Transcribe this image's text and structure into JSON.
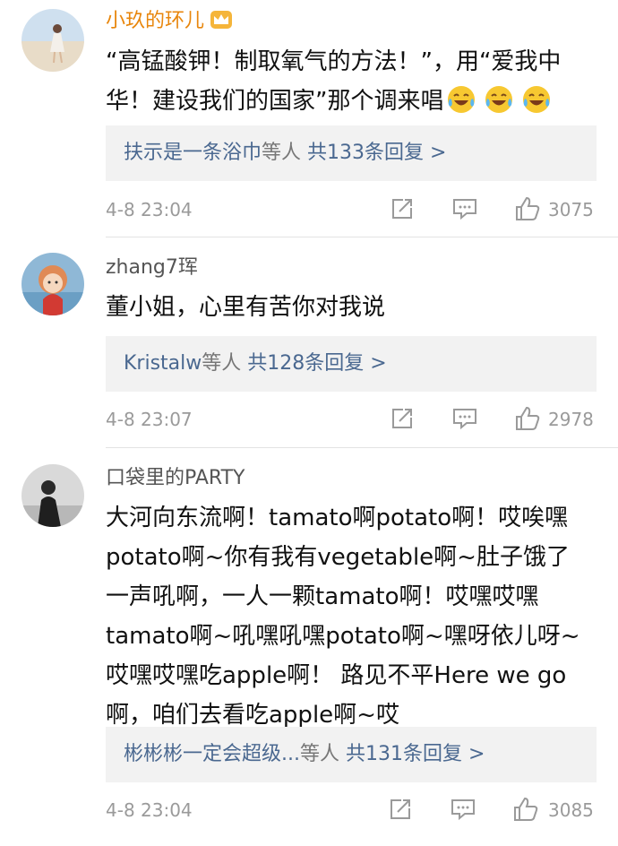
{
  "comments": [
    {
      "username": "小玖的环儿",
      "username_color": "#e8860c",
      "badge": "crown-icon",
      "lines": [
        "“高锰酸钾！制取氧气的方法！”，用“爱我中",
        "华！建设我们的国家”那个调来唱"
      ],
      "emoji": "laughing-tears-emoji",
      "emoji_count": 3,
      "reply_names": "扶示是一条浴巾",
      "reply_mid": "等人",
      "reply_count": "共133条回复 >",
      "time": "4-8 23:04",
      "likes": "3075"
    },
    {
      "username": "zhang7珲",
      "username_color": "#555555",
      "lines": [
        "董小姐，心里有苦你对我说"
      ],
      "reply_names": "Kristalw",
      "reply_mid": "等人",
      "reply_count": "共128条回复 >",
      "time": "4-8 23:07",
      "likes": "2978"
    },
    {
      "username": "口袋里的PARTY",
      "username_color": "#555555",
      "lines": [
        "大河向东流啊！tamato啊potato啊！哎唉嘿",
        "potato啊~你有我有vegetable啊~肚子饿了",
        "一声吼啊，一人一颗tamato啊！哎嘿哎嘿",
        "tamato啊~吼嘿吼嘿potato啊~嘿呀依儿呀~",
        "哎嘿哎嘿吃apple啊！ 路见不平Here we go",
        "啊，咱们去看吃apple啊~哎"
      ],
      "reply_names": "彬彬彬一定会超级...",
      "reply_mid": "等人",
      "reply_count": "共131条回复 >",
      "time": "4-8 23:04",
      "likes": "3085"
    }
  ],
  "icons": [
    "share-icon",
    "comment-icon",
    "like-thumb-icon"
  ],
  "colors": {
    "link": "#4a6890",
    "meta": "#9a9a9a",
    "reply_bg": "#f2f2f2"
  }
}
